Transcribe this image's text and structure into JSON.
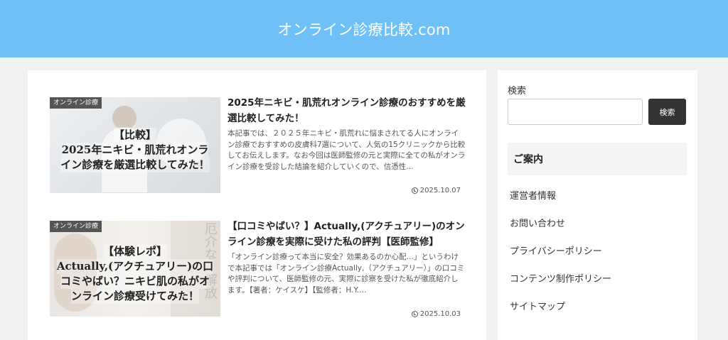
{
  "site": {
    "title": "オンライン診療比較.com"
  },
  "posts": [
    {
      "category": "オンライン診療",
      "thumb_lines": [
        "【比較】",
        "2025年ニキビ・肌荒れオンラ",
        "イン診療を厳選比較してみた！"
      ],
      "title": "2025年ニキビ・肌荒れオンライン診療のおすすめを厳選比較してみた！",
      "excerpt": "本記事では、２０２５年ニキビ・肌荒れに悩まされてる人にオンライン診療でおすすめの皮膚科7選について、人気の15クリニックから比較してお伝えします。なお今回は医師監修の元と実際に全ての私がオンライン診療を受診した結論を紹介していくので、信憑性…",
      "date": "2025.10.07"
    },
    {
      "category": "オンライン診療",
      "thumb_lines": [
        "【体験レポ】",
        "Actually,(アクチュアリー)の口",
        "コミやばい？ニキビ肌の私がオ",
        "ンライン診療受けてみた！"
      ],
      "thumb_side_text": "厄介な　解放",
      "title": "【口コミやばい？】Actually,(アクチュアリー)のオンライン診療を実際に受けた私の評判【医師監修】",
      "excerpt": "「オンライン診療って本当に安全？効果あるのか心配…」というわけで本記事では「オンライン診療Actually,（アクチュアリー）」の口コミや評判について、医師監修の元、実際に診察を受けた私が徹底紹介します。【著者：ケイスケ】【監修者：H.Y.…",
      "date": "2025.10.03"
    }
  ],
  "sidebar": {
    "search_label": "検索",
    "search_value": "",
    "search_button": "検索",
    "widget_title": "ご案内",
    "menu": [
      "運営者情報",
      "お問い合わせ",
      "プライバシーポリシー",
      "コンテンツ制作ポリシー",
      "サイトマップ"
    ]
  },
  "icons": {
    "date": "clock-icon"
  },
  "colors": {
    "header": "#70c0f8",
    "button": "#333333"
  }
}
